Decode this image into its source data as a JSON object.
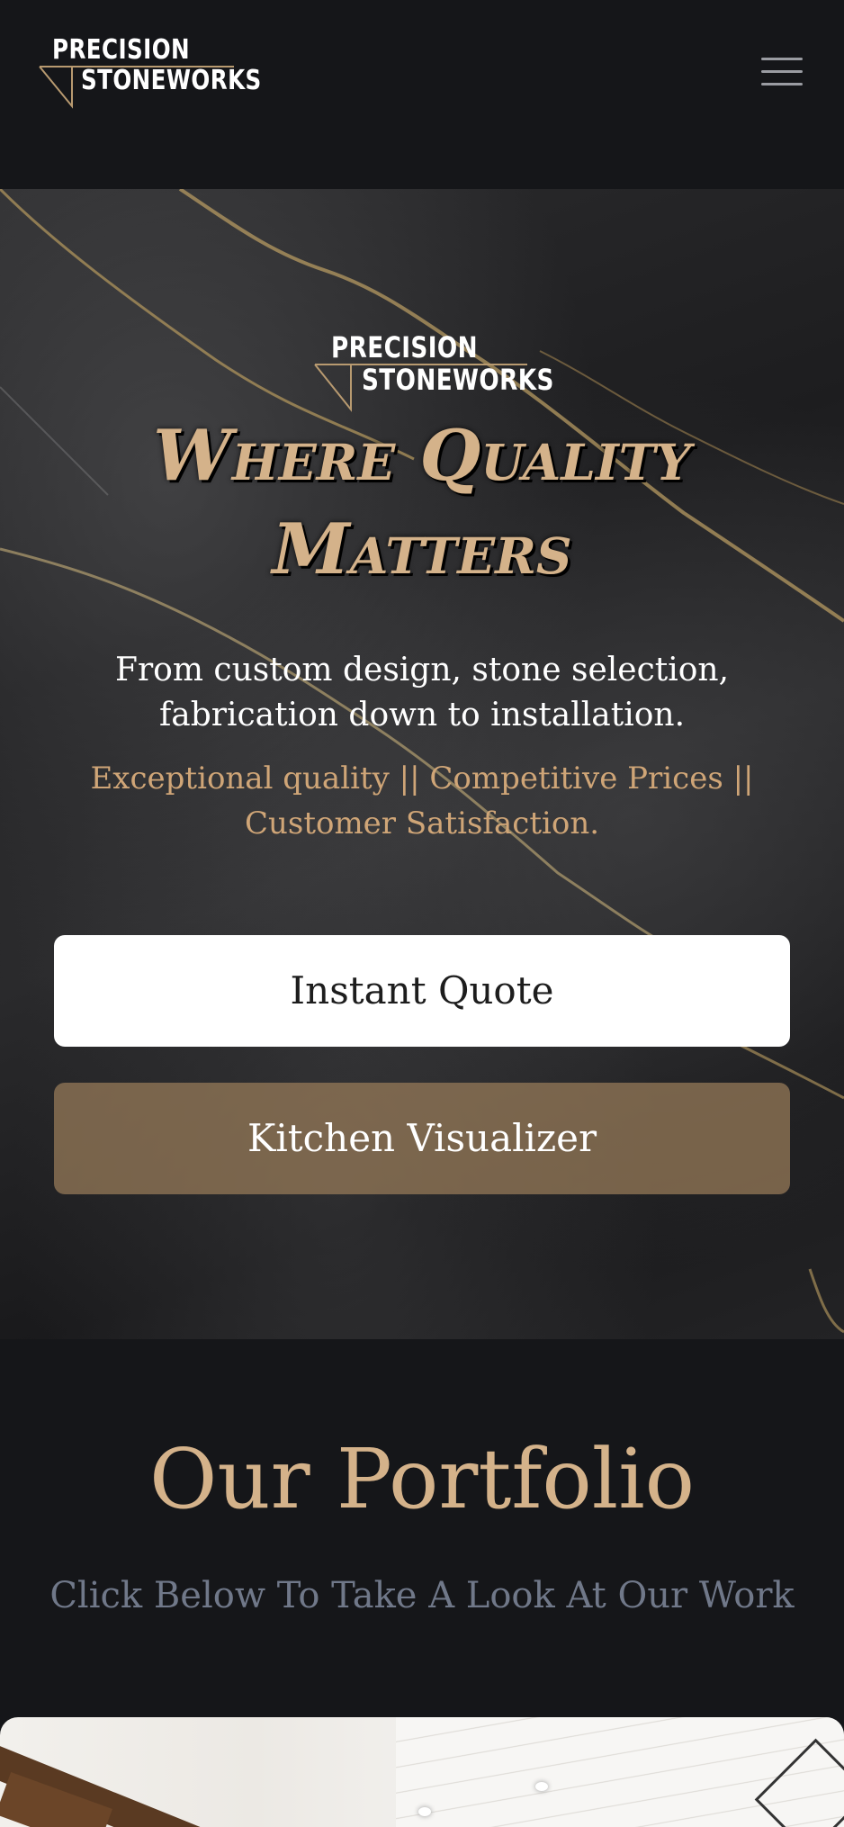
{
  "header": {
    "logo_line1": "PRECISION",
    "logo_line2": "STONEWORKS",
    "menu_icon": "hamburger-menu-icon"
  },
  "hero": {
    "logo_line1": "PRECISION",
    "logo_line2": "STONEWORKS",
    "headline_line1": "Where Quality",
    "headline_line2": "Matters",
    "subtext": "From custom design, stone selection, fabrication down to installation.",
    "tagline": "Exceptional quality || Competitive Prices || Customer Satisfaction.",
    "buttons": {
      "quote": "Instant Quote",
      "visualizer": "Kitchen Visualizer"
    }
  },
  "portfolio": {
    "title": "Our Portfolio",
    "subtitle": "Click Below To Take A Look At Our Work"
  },
  "colors": {
    "background": "#151619",
    "gold": "#d4b28a",
    "tagline_gold": "#cfa577",
    "muted": "#707889",
    "button_brown": "#967a58"
  }
}
